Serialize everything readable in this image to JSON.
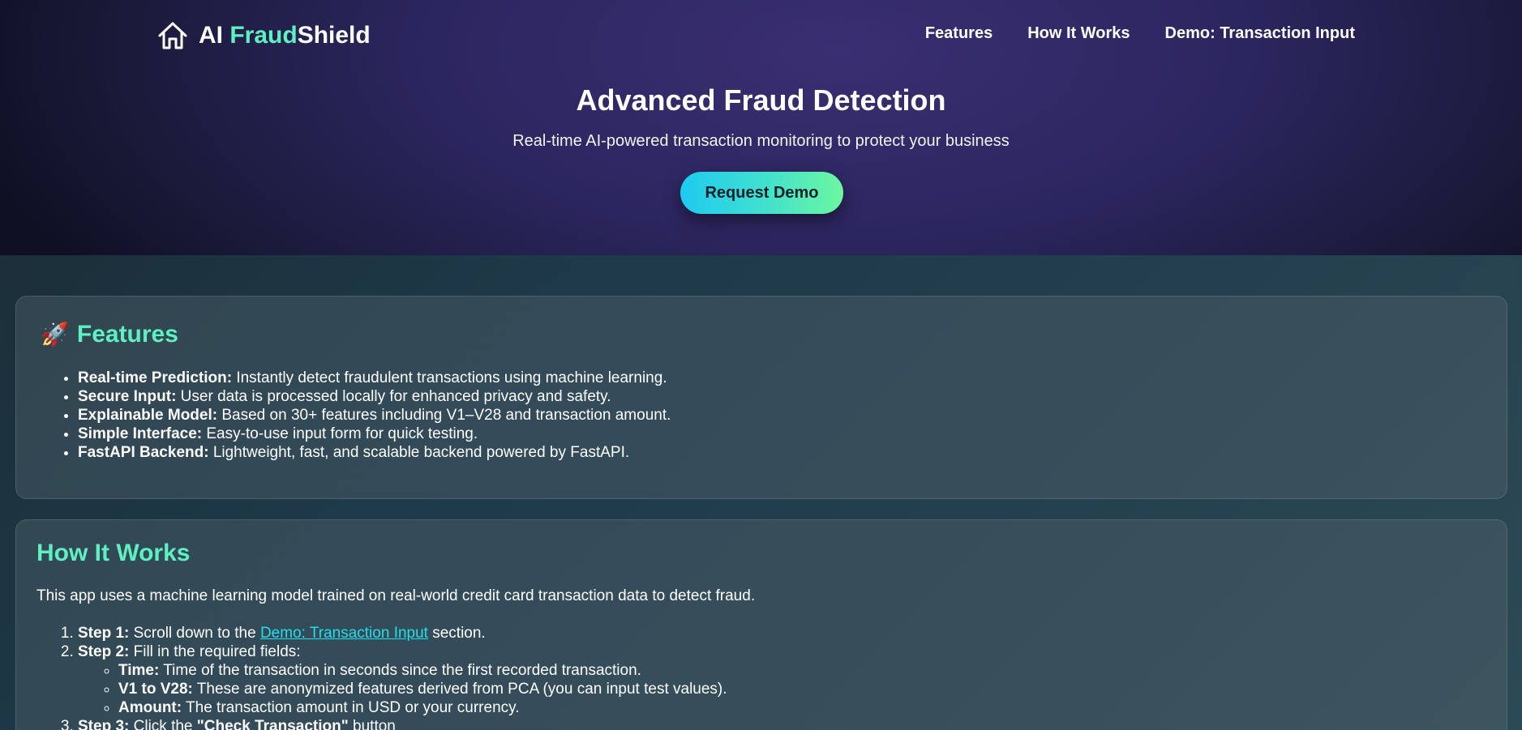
{
  "header": {
    "brand": {
      "part1": "AI ",
      "part2": "Fraud",
      "part3": "Shield"
    },
    "nav": [
      "Features",
      "How It Works",
      "Demo: Transaction Input"
    ]
  },
  "hero": {
    "title": "Advanced Fraud Detection",
    "subtitle": "Real-time AI-powered transaction monitoring to protect your business",
    "cta": "Request Demo"
  },
  "features": {
    "icon": "rocket-icon",
    "title": "Features",
    "items": [
      {
        "label": "Real-time Prediction:",
        "text": " Instantly detect fraudulent transactions using machine learning."
      },
      {
        "label": "Secure Input:",
        "text": " User data is processed locally for enhanced privacy and safety."
      },
      {
        "label": "Explainable Model:",
        "text": " Based on 30+ features including V1–V28 and transaction amount."
      },
      {
        "label": "Simple Interface:",
        "text": " Easy-to-use input form for quick testing."
      },
      {
        "label": "FastAPI Backend:",
        "text": " Lightweight, fast, and scalable backend powered by FastAPI."
      }
    ]
  },
  "how": {
    "title": "How It Works",
    "intro": "This app uses a machine learning model trained on real-world credit card transaction data to detect fraud.",
    "step1": {
      "label": "Step 1:",
      "pre": " Scroll down to the ",
      "link": "Demo: Transaction Input",
      "post": " section."
    },
    "step2": {
      "label": "Step 2:",
      "text": " Fill in the required fields:"
    },
    "fields": [
      {
        "label": "Time:",
        "text": " Time of the transaction in seconds since the first recorded transaction."
      },
      {
        "label": "V1 to V28:",
        "text": " These are anonymized features derived from PCA (you can input test values)."
      },
      {
        "label": "Amount:",
        "text": " The transaction amount in USD or your currency."
      }
    ],
    "step3": {
      "label": "Step 3:",
      "pre": " Click the ",
      "strong": "\"Check Transaction\"",
      "post": " button"
    }
  },
  "colors": {
    "accent": "#5ef0c0",
    "link": "#22dfe8",
    "cta_start": "#1ecbf0",
    "cta_end": "#6cf7a0"
  }
}
